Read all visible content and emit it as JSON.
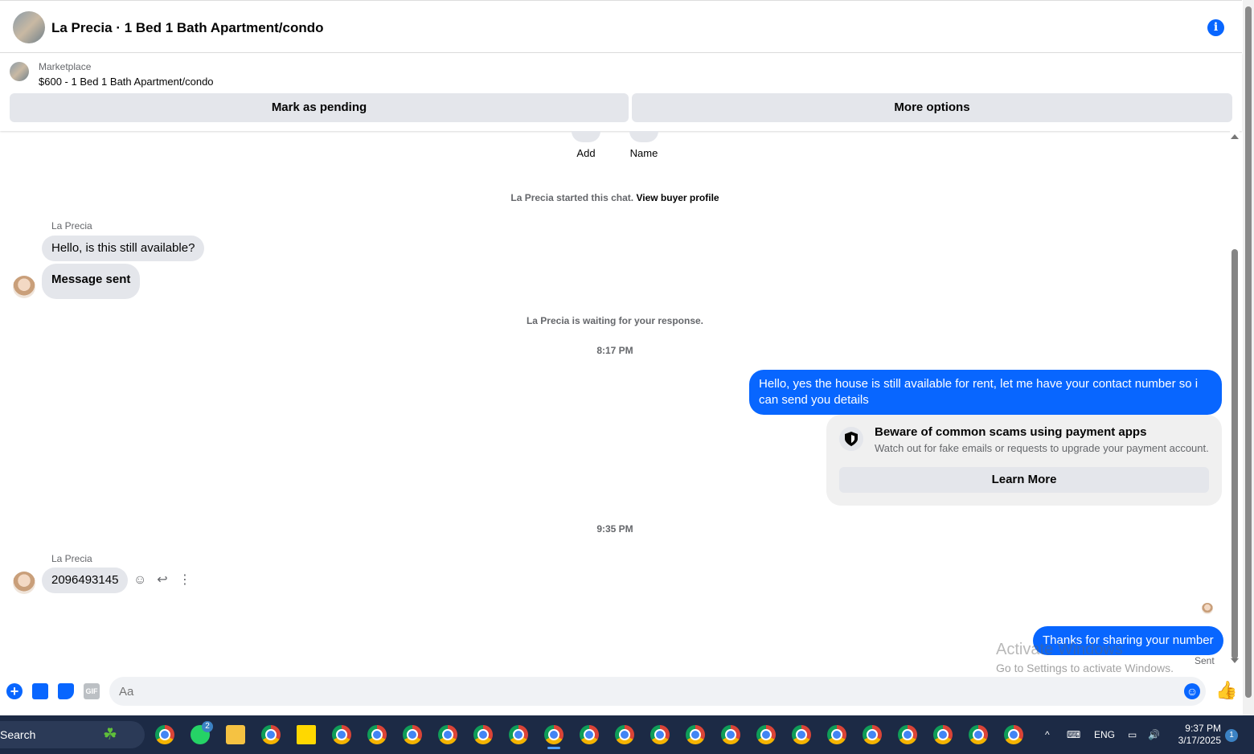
{
  "header": {
    "title": "La Precia · 1 Bed 1 Bath Apartment/condo",
    "info_icon": "info-icon"
  },
  "marketplace": {
    "label": "Marketplace",
    "listing": "$600 - 1 Bed 1 Bath Apartment/condo",
    "mark_pending": "Mark as pending",
    "more_options": "More options"
  },
  "top_actions": {
    "add": "Add",
    "name": "Name"
  },
  "chat": {
    "started_prefix": "La Precia started this chat.",
    "view_profile": "View buyer profile",
    "sender1": "La Precia",
    "msg1": "Hello, is this still available?",
    "msg2": "Message sent",
    "waiting": "La Precia is waiting for your response.",
    "time1": "8:17 PM",
    "out1": "Hello, yes the house is still available for rent, let me have your contact number so i can send you  details",
    "scam_title": "Beware of common scams using payment apps",
    "scam_desc": "Watch out for fake emails or requests to upgrade your payment account.",
    "learn_more": "Learn More",
    "time2": "9:35 PM",
    "sender2": "La Precia",
    "msg3": "2096493145",
    "out2": "Thanks for sharing your number",
    "sent_label": "Sent"
  },
  "watermark": {
    "line1": "Activate Windows",
    "line2": "Go to Settings to activate Windows."
  },
  "composer": {
    "placeholder": "Aa",
    "gif_label": "GIF"
  },
  "taskbar": {
    "search_label": "Search",
    "whatsapp_badge": "2",
    "lang": "ENG",
    "time": "9:37 PM",
    "date": "3/17/2025",
    "notifications": "1"
  },
  "colors": {
    "accent": "#0866ff",
    "bubble_in": "#e4e6eb",
    "taskbar": "#1c2a45"
  }
}
